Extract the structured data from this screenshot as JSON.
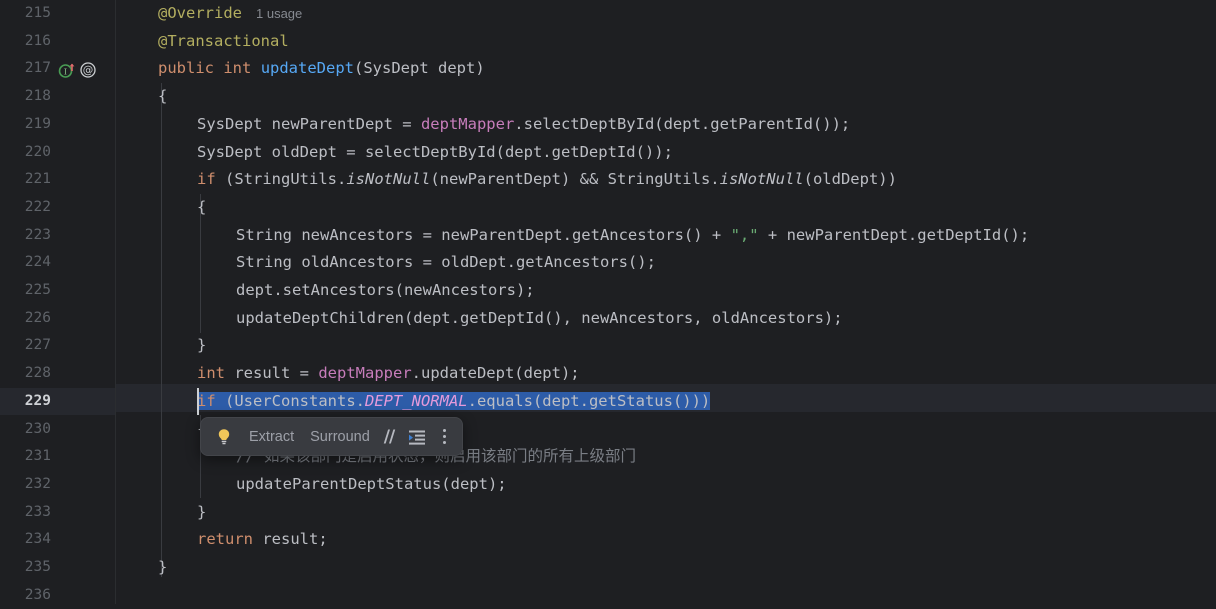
{
  "editor": {
    "theme_background": "#1e1f22",
    "current_line_background": "#26282e",
    "selection_background": "#2d5ca8",
    "first_line_number": 215,
    "current_line_number": 229,
    "lines": [
      {
        "num": "215",
        "text": "@Override  1 usage"
      },
      {
        "num": "216",
        "text": "@Transactional"
      },
      {
        "num": "217",
        "text": "public int updateDept(SysDept dept)"
      },
      {
        "num": "218",
        "text": "{"
      },
      {
        "num": "219",
        "text": "SysDept newParentDept = deptMapper.selectDeptById(dept.getParentId());"
      },
      {
        "num": "220",
        "text": "SysDept oldDept = selectDeptById(dept.getDeptId());"
      },
      {
        "num": "221",
        "text": "if (StringUtils.isNotNull(newParentDept) && StringUtils.isNotNull(oldDept))"
      },
      {
        "num": "222",
        "text": "{"
      },
      {
        "num": "223",
        "text": "String newAncestors = newParentDept.getAncestors() + \",\" + newParentDept.getDeptId();"
      },
      {
        "num": "224",
        "text": "String oldAncestors = oldDept.getAncestors();"
      },
      {
        "num": "225",
        "text": "dept.setAncestors(newAncestors);"
      },
      {
        "num": "226",
        "text": "updateDeptChildren(dept.getDeptId(), newAncestors, oldAncestors);"
      },
      {
        "num": "227",
        "text": "}"
      },
      {
        "num": "228",
        "text": "int result = deptMapper.updateDept(dept);"
      },
      {
        "num": "229",
        "text": "if (UserConstants.DEPT_NORMAL.equals(dept.getStatus()))"
      },
      {
        "num": "230",
        "text": "{"
      },
      {
        "num": "231",
        "text": "// 如果该部门是启用状态，则启用该部门的所有上级部门"
      },
      {
        "num": "232",
        "text": "updateParentDeptStatus(dept);"
      },
      {
        "num": "233",
        "text": "}"
      },
      {
        "num": "234",
        "text": "return result;"
      },
      {
        "num": "235",
        "text": "}"
      },
      {
        "num": "236",
        "text": ""
      }
    ],
    "inlay_hint": "1 usage",
    "selected_text": "if (UserConstants.DEPT_NORMAL.equals(dept.getStatus()))",
    "gutter_icons": [
      {
        "name": "implementing-method-icon",
        "glyph": "I",
        "color": "#499C54",
        "arrow_color": "#e06c6c"
      },
      {
        "name": "annotation-icon",
        "glyph": "@",
        "color": "#cdd0d3"
      }
    ]
  },
  "tokens": {
    "l215_anno": "@Override",
    "l216_anno": "@Transactional",
    "l217_kw1": "public",
    "l217_kw2": "int",
    "l217_method": "updateDept",
    "l217_params": "(SysDept dept)",
    "l218": "{",
    "l219_a": "SysDept newParentDept = ",
    "l219_field": "deptMapper",
    "l219_b": ".selectDeptById(dept.getParentId());",
    "l220": "SysDept oldDept = selectDeptById(dept.getDeptId());",
    "l221_kw": "if",
    "l221_a": " (StringUtils.",
    "l221_m1": "isNotNull",
    "l221_b": "(newParentDept) && StringUtils.",
    "l221_m2": "isNotNull",
    "l221_c": "(oldDept))",
    "l222": "{",
    "l223_a": "String newAncestors = newParentDept.getAncestors() + ",
    "l223_str": "\",\"",
    "l223_b": " + newParentDept.getDeptId();",
    "l224": "String oldAncestors = oldDept.getAncestors();",
    "l225": "dept.setAncestors(newAncestors);",
    "l226": "updateDeptChildren(dept.getDeptId(), newAncestors, oldAncestors);",
    "l227": "}",
    "l228_kw": "int",
    "l228_a": " result = ",
    "l228_field": "deptMapper",
    "l228_b": ".updateDept(dept);",
    "l229_kw": "if",
    "l229_a": " (UserConstants.",
    "l229_const": "DEPT_NORMAL",
    "l229_b": ".equals(dept.getStatus()))",
    "l230": "{",
    "l231_comment": "// 如果该部门是启用状态，则启用该部门的所有上级部门",
    "l232": "updateParentDeptStatus(dept);",
    "l233": "}",
    "l234_kw": "return",
    "l234_a": " result;",
    "l235": "}"
  },
  "float_toolbar": {
    "bulb_icon": "lightbulb-icon",
    "extract_label": "Extract",
    "surround_label": "Surround",
    "comment_icon_label": "//",
    "reformat_icon": "indent-lines-icon",
    "more_icon": "more-options-icon"
  }
}
